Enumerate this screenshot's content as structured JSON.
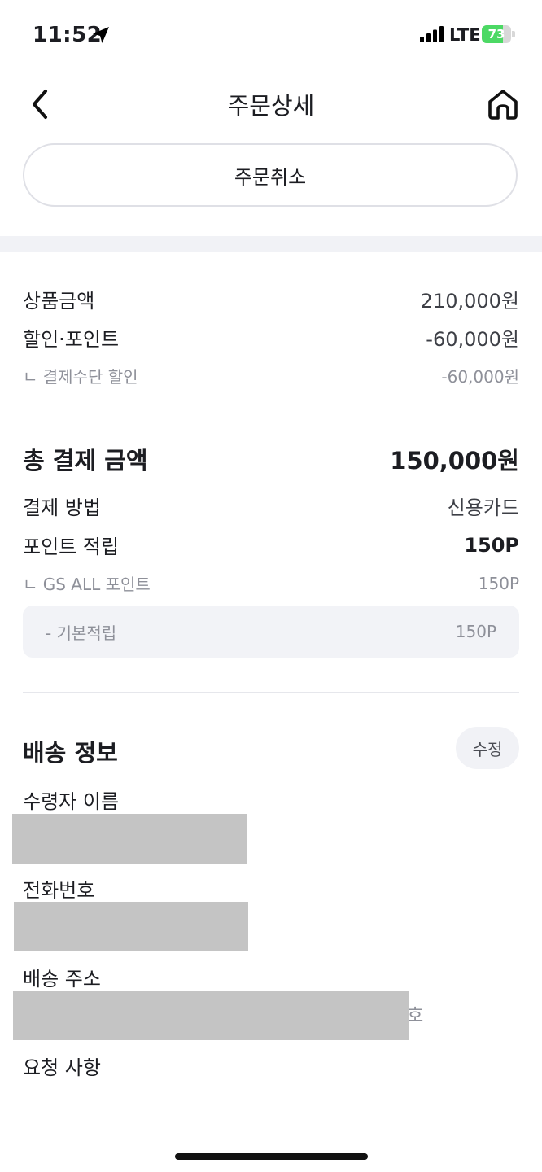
{
  "status_bar": {
    "time": "11:52",
    "network": "LTE",
    "battery_percent": 73,
    "battery_label": "73",
    "battery_color": "#4cd964",
    "icons": [
      "location-arrow-icon",
      "signal-icon",
      "battery-icon"
    ]
  },
  "header": {
    "title": "주문상세",
    "back_icon": "chevron-left-icon",
    "home_icon": "home-icon"
  },
  "actions": {
    "cancel_label": "주문취소"
  },
  "payment_summary": {
    "product_amount_label": "상품금액",
    "product_amount_value": "210,000원",
    "discount_label": "할인·포인트",
    "discount_value": "-60,000원",
    "method_discount_label": "ㄴ 결제수단 할인",
    "method_discount_value": "-60,000원"
  },
  "total": {
    "label": "총 결제 금액",
    "value": "150,000원",
    "method_label": "결제 방법",
    "method_value": "신용카드",
    "points_label": "포인트 적립",
    "points_value": "150P",
    "gs_label": "ㄴ GS ALL 포인트",
    "gs_value": "150P",
    "basic_label": "- 기본적립",
    "basic_value": "150P"
  },
  "delivery": {
    "title": "배송 정보",
    "edit_label": "수정",
    "recipient_label": "수령자 이름",
    "phone_label": "전화번호",
    "address_label": "배송 주소",
    "address_peek": "호",
    "request_label": "요청 사항"
  },
  "colors": {
    "accent_gray": "#f1f2f6",
    "redaction": "#c4c4c4",
    "text_primary": "#1c1d22",
    "text_secondary": "#8e9099"
  }
}
